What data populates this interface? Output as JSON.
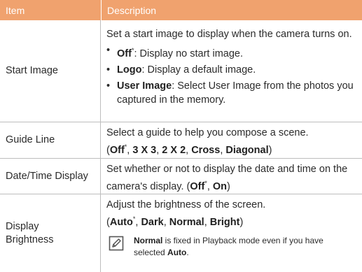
{
  "header": {
    "item": "Item",
    "description": "Description"
  },
  "rows": [
    {
      "label": "Start Image",
      "intro": "Set a start image to display when the camera turns on.",
      "bullets": [
        {
          "term": "Off",
          "mark": "*",
          "text": ": Display no start image."
        },
        {
          "term": "Logo",
          "mark": "",
          "text": ": Display a default image."
        },
        {
          "term": "User Image",
          "mark": "",
          "text": ": Select User Image from the photos you captured in the memory."
        }
      ]
    },
    {
      "label": "Guide Line",
      "intro": "Select a guide to help you compose a scene.",
      "options": [
        {
          "term": "Off",
          "mark": "*"
        },
        {
          "term": "3 X 3",
          "mark": ""
        },
        {
          "term": "2 X 2",
          "mark": ""
        },
        {
          "term": "Cross",
          "mark": ""
        },
        {
          "term": "Diagonal",
          "mark": ""
        }
      ]
    },
    {
      "label": "Date/Time Display",
      "intro": "Set whether or not to display the date and time on the camera's display.",
      "options": [
        {
          "term": "Off",
          "mark": "*"
        },
        {
          "term": "On",
          "mark": ""
        }
      ]
    },
    {
      "label": "Display Brightness",
      "intro": "Adjust the brightness of the screen.",
      "options": [
        {
          "term": "Auto",
          "mark": "*"
        },
        {
          "term": "Dark",
          "mark": ""
        },
        {
          "term": "Normal",
          "mark": ""
        },
        {
          "term": "Bright",
          "mark": ""
        }
      ],
      "note": {
        "term": "Normal",
        "text": " is fixed in Playback mode even if you have selected ",
        "term2": "Auto",
        "end": "."
      }
    }
  ],
  "icons": {
    "note": "pencil-note-icon"
  },
  "colors": {
    "header_bg": "#f0a26e",
    "header_text": "#ffffff",
    "rule": "#bdbdbd"
  }
}
